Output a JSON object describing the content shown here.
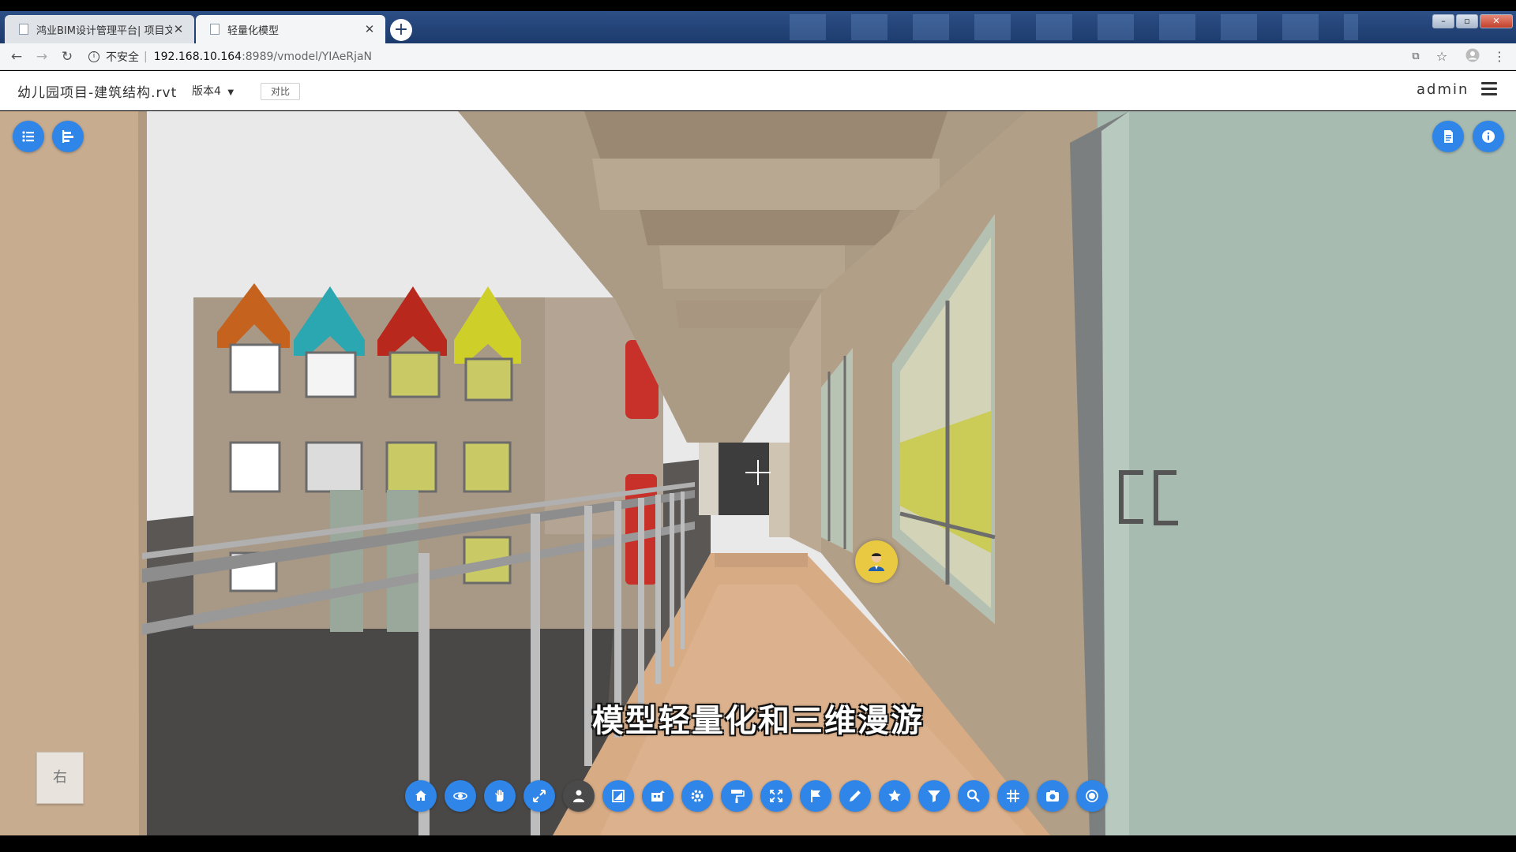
{
  "browser": {
    "tabs": [
      {
        "label": "鸿业BIM设计管理平台| 项目文件",
        "active": false
      },
      {
        "label": "轻量化模型",
        "active": true
      }
    ],
    "new_tab": "+",
    "url_security": "不安全",
    "url_host": "192.168.10.164",
    "url_path": ":8989/vmodel/YIAeRjaN"
  },
  "header": {
    "project_title": "幼儿园项目-建筑结构.rvt",
    "version_label": "版本4",
    "compare_label": "对比",
    "user_name": "admin"
  },
  "viewport": {
    "viewcube_label": "右",
    "caption": "模型轻量化和三维漫游"
  },
  "colors": {
    "accent": "#2f86e8",
    "walker": "#e8c941"
  },
  "toolbar_icons": [
    "home-icon",
    "orbit-icon",
    "pan-icon",
    "fit-icon",
    "walk-icon",
    "section-icon",
    "floor-icon",
    "settings-icon",
    "paint-roller-icon",
    "fullscreen-icon",
    "flag-icon",
    "pencil-icon",
    "star-icon",
    "filter-icon",
    "search-icon",
    "grid-icon",
    "camera-icon",
    "record-icon"
  ]
}
